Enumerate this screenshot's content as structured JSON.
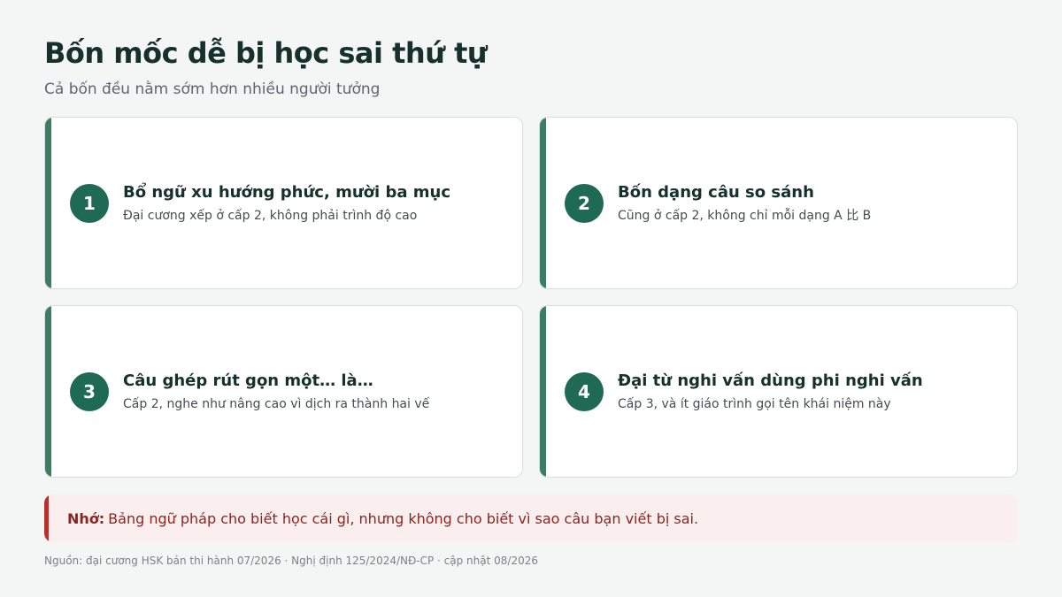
{
  "title": "Bốn mốc dễ bị học sai thứ tự",
  "subtitle": "Cả bốn đều nằm sớm hơn nhiều người tưởng",
  "cards": [
    {
      "number": "1",
      "title": "Bổ ngữ xu hướng phức, mười ba mục",
      "desc": "Đại cương xếp ở cấp 2, không phải trình độ cao"
    },
    {
      "number": "2",
      "title": "Bốn dạng câu so sánh",
      "desc": "Cũng ở cấp 2, không chỉ mỗi dạng A 比 B"
    },
    {
      "number": "3",
      "title": "Câu ghép rút gọn một… là…",
      "desc": "Cấp 2, nghe như nâng cao vì dịch ra thành hai vế"
    },
    {
      "number": "4",
      "title": "Đại từ nghi vấn dùng phi nghi vấn",
      "desc": "Cấp 3, và ít giáo trình gọi tên khái niệm này"
    }
  ],
  "note": {
    "label": "Nhớ:",
    "text": "Bảng ngữ pháp cho biết học cái gì, nhưng không cho biết vì sao câu bạn viết bị sai."
  },
  "source": "Nguồn: đại cương HSK bản thi hành 07/2026 · Nghị định 125/2024/NĐ-CP · cập nhật 08/2026",
  "colors": {
    "accent": "#1e6a52",
    "card_border_accent": "#3d7d63",
    "note_accent": "#b3322b",
    "note_background": "#fbeeee"
  }
}
